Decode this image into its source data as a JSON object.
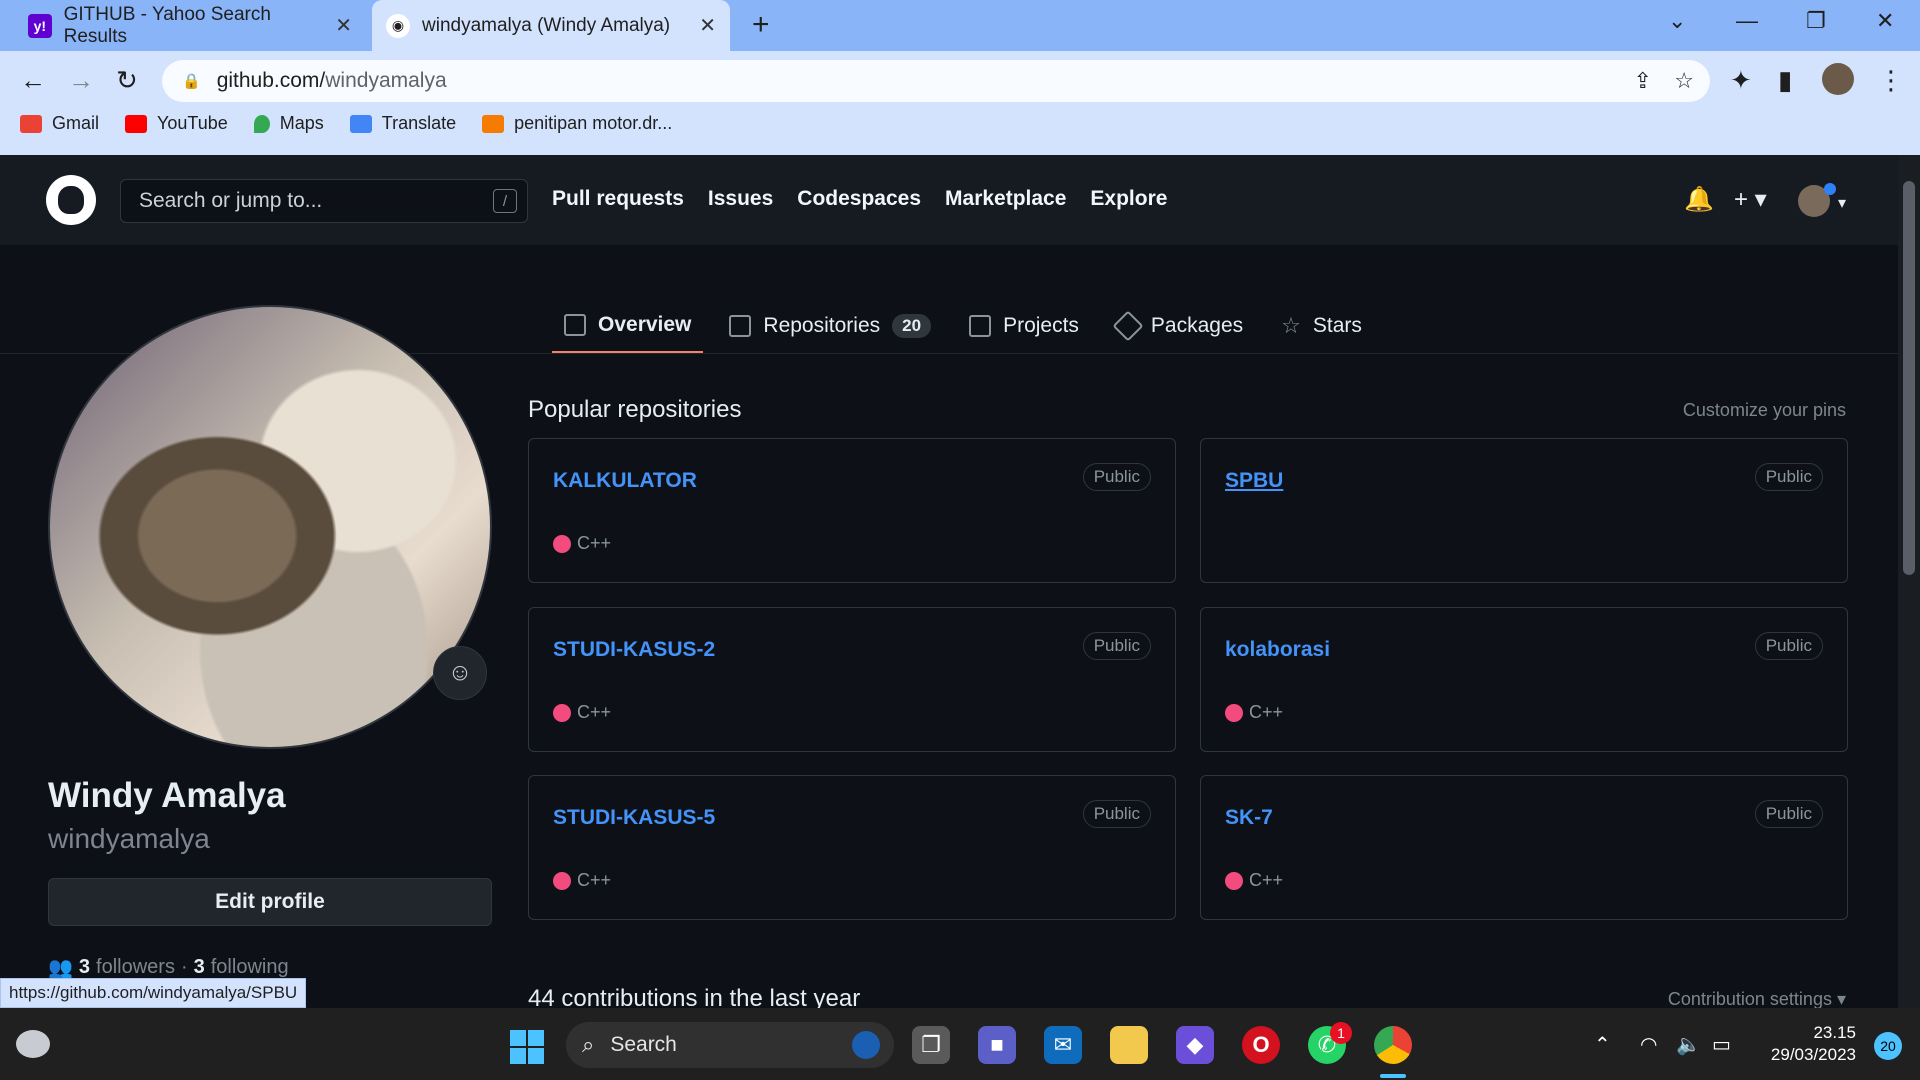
{
  "browser": {
    "tabs": [
      {
        "label": "GITHUB - Yahoo Search Results",
        "favicon": "yahoo-icon"
      },
      {
        "label": "windyamalya (Windy Amalya)",
        "favicon": "github-icon"
      }
    ],
    "url_host": "github.com/",
    "url_path": "windyamalya",
    "bookmarks": [
      {
        "label": "Gmail",
        "color": "#ea4335"
      },
      {
        "label": "YouTube",
        "color": "#ff0000"
      },
      {
        "label": "Maps",
        "color": "#34a853"
      },
      {
        "label": "Translate",
        "color": "#4285f4"
      },
      {
        "label": "penitipan motor.dr...",
        "color": "#f57c00"
      }
    ],
    "status_url": "https://github.com/windyamalya/SPBU"
  },
  "github": {
    "search_placeholder": "Search or jump to...",
    "search_shortcut": "/",
    "nav": [
      "Pull requests",
      "Issues",
      "Codespaces",
      "Marketplace",
      "Explore"
    ],
    "profile_tabs": [
      {
        "label": "Overview",
        "icon": "book-icon"
      },
      {
        "label": "Repositories",
        "icon": "repo-icon",
        "count": "20"
      },
      {
        "label": "Projects",
        "icon": "table-icon"
      },
      {
        "label": "Packages",
        "icon": "package-icon"
      },
      {
        "label": "Stars",
        "icon": "star-icon"
      }
    ],
    "profile": {
      "fullname": "Windy Amalya",
      "username": "windyamalya",
      "edit_label": "Edit profile",
      "followers_count": "3",
      "followers_label": "followers",
      "separator": "·",
      "following_count": "3",
      "following_label": "following"
    },
    "popular_title": "Popular repositories",
    "customize_label": "Customize your pins",
    "repos": [
      {
        "name": "KALKULATOR",
        "visibility": "Public",
        "language": "C++"
      },
      {
        "name": "SPBU",
        "visibility": "Public",
        "language": ""
      },
      {
        "name": "STUDI-KASUS-2",
        "visibility": "Public",
        "language": "C++"
      },
      {
        "name": "kolaborasi",
        "visibility": "Public",
        "language": "C++"
      },
      {
        "name": "STUDI-KASUS-5",
        "visibility": "Public",
        "language": "C++"
      },
      {
        "name": "SK-7",
        "visibility": "Public",
        "language": "C++"
      }
    ],
    "contributions_title": "44 contributions in the last year",
    "contribution_settings": "Contribution settings ▾"
  },
  "taskbar": {
    "search_label": "Search",
    "time": "23.15",
    "date": "29/03/2023",
    "notification_count": "20",
    "whatsapp_badge": "1"
  }
}
